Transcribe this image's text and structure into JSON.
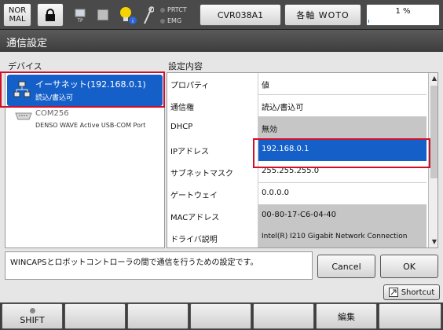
{
  "toolbar": {
    "mode_top": "NOR",
    "mode_bottom": "MAL",
    "tp_label": "TP",
    "prtct_label": "PRTCT",
    "emg_label": "EMG",
    "controller": "CVR038A1",
    "axis_label": "各軸 WOTO",
    "speed": "1 %",
    "speed_percent": 1
  },
  "title": "通信設定",
  "devices_label": "デバイス",
  "settings_label": "設定内容",
  "devices": [
    {
      "name": "イーサネット(192.168.0.1)",
      "sub": "読込/書込可",
      "icon": "ethernet-network-icon"
    },
    {
      "name": "COM256",
      "sub": "DENSO WAVE Active USB-COM Port",
      "icon": "com-port-icon"
    }
  ],
  "table": {
    "header": {
      "prop": "プロパティ",
      "value": "値"
    },
    "rows": [
      {
        "prop": "通信権",
        "value": "読込/書込可",
        "state": "normal"
      },
      {
        "prop": "DHCP",
        "value": "無効",
        "state": "gray"
      },
      {
        "prop": "IPアドレス",
        "value": "192.168.0.1",
        "state": "selected"
      },
      {
        "prop": "サブネットマスク",
        "value": "255.255.255.0",
        "state": "normal"
      },
      {
        "prop": "ゲートウェイ",
        "value": "0.0.0.0",
        "state": "normal"
      },
      {
        "prop": "MACアドレス",
        "value": "00-80-17-C6-04-40",
        "state": "gray"
      },
      {
        "prop": "ドライバ説明",
        "value": "Intel(R) I210 Gigabit Network Connection",
        "state": "gray"
      }
    ]
  },
  "message": "WINCAPSとロボットコントローラの間で通信を行うための設定です。",
  "buttons": {
    "cancel": "Cancel",
    "ok": "OK",
    "shortcut": "Shortcut"
  },
  "fkeys": [
    "SHIFT",
    "",
    "",
    "",
    "",
    "編集",
    ""
  ],
  "colors": {
    "selected": "#1560c8",
    "highlight": "#d0102a",
    "gray_cell": "#c6c6c6"
  }
}
